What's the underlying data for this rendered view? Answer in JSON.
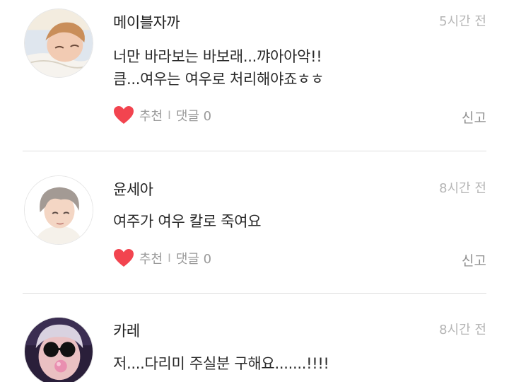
{
  "comments": [
    {
      "author": "메이블자까",
      "time": "5시간 전",
      "lines": [
        "너만 바라보는 바보래...꺄아아악!!",
        "큼...여우는 여우로 처리해야죠ㅎㅎ"
      ],
      "like_label": "추천",
      "separator": "I",
      "reply_label": "댓글 0",
      "report_label": "신고"
    },
    {
      "author": "윤세아",
      "time": "8시간 전",
      "lines": [
        "여주가 여우 칼로 죽여요"
      ],
      "like_label": "추천",
      "separator": "I",
      "reply_label": "댓글 0",
      "report_label": "신고"
    },
    {
      "author": "카레",
      "time": "8시간 전",
      "lines": [
        "저....다리미 주실분 구해요.......!!!!"
      ]
    }
  ],
  "colors": {
    "heart": "#f2444f",
    "divider": "#dedede",
    "meta_text": "#9a9a9a"
  },
  "icons": {
    "like": "heart-icon"
  }
}
